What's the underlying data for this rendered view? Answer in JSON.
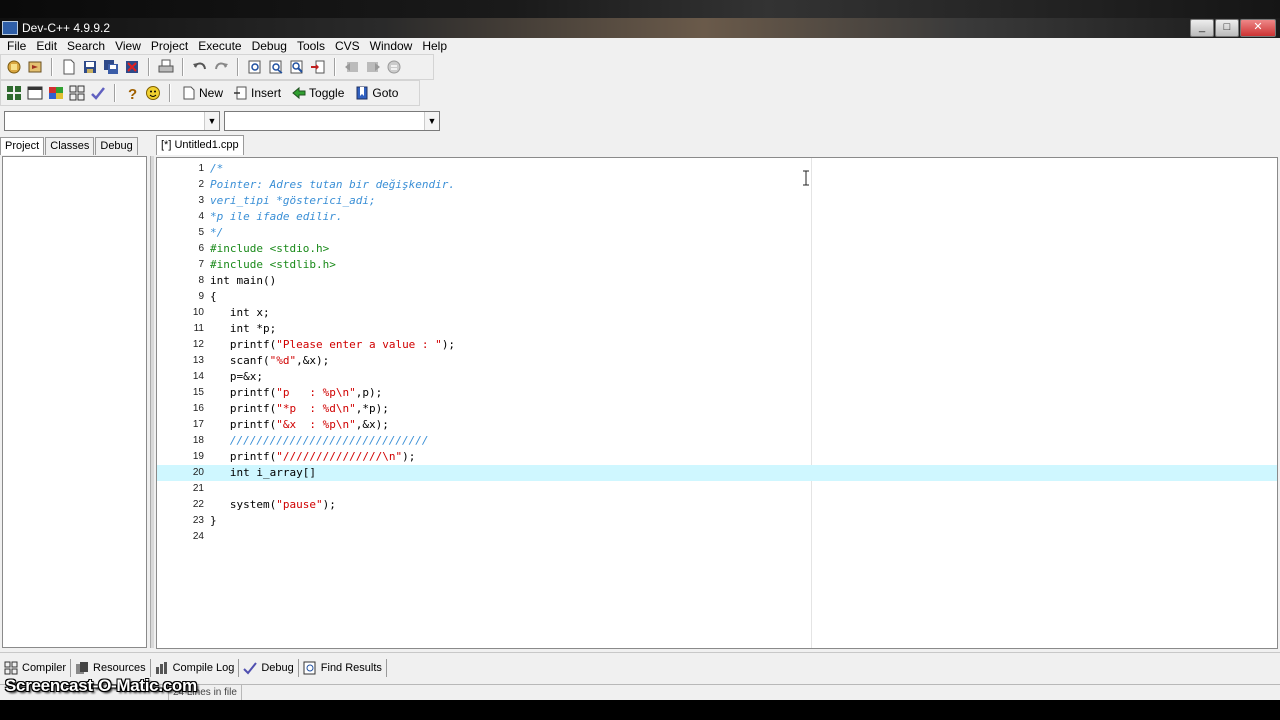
{
  "window": {
    "title": "Dev-C++ 4.9.9.2",
    "controls": [
      "_",
      "□",
      "✕"
    ]
  },
  "menu": [
    "File",
    "Edit",
    "Search",
    "View",
    "Project",
    "Execute",
    "Debug",
    "Tools",
    "CVS",
    "Window",
    "Help"
  ],
  "toolbar2": {
    "new_label": "New",
    "insert_label": "Insert",
    "toggle_label": "Toggle",
    "goto_label": "Goto"
  },
  "left_tabs": [
    "Project",
    "Classes",
    "Debug"
  ],
  "editor": {
    "tab_label": "[*] Untitled1.cpp",
    "current_line": 20,
    "lines": [
      {
        "n": "1",
        "segs": [
          {
            "t": "/*",
            "c": "comment"
          }
        ]
      },
      {
        "n": "2",
        "segs": [
          {
            "t": "Pointer: Adres tutan bir değişkendir.",
            "c": "comment"
          }
        ]
      },
      {
        "n": "3",
        "segs": [
          {
            "t": "veri_tipi *gösterici_adi;",
            "c": "comment"
          }
        ]
      },
      {
        "n": "4",
        "segs": [
          {
            "t": "*p ile ifade edilir.",
            "c": "comment"
          }
        ]
      },
      {
        "n": "5",
        "segs": [
          {
            "t": "*/",
            "c": "comment"
          }
        ]
      },
      {
        "n": "6",
        "segs": [
          {
            "t": "#include <stdio.h>",
            "c": "pre"
          }
        ]
      },
      {
        "n": "7",
        "segs": [
          {
            "t": "#include <stdlib.h>",
            "c": "pre"
          }
        ]
      },
      {
        "n": "8",
        "segs": [
          {
            "t": "int main()",
            "c": "norm"
          }
        ]
      },
      {
        "n": "9",
        "segs": [
          {
            "t": "{",
            "c": "norm"
          }
        ]
      },
      {
        "n": "10",
        "segs": [
          {
            "t": "   int x;",
            "c": "norm"
          }
        ]
      },
      {
        "n": "11",
        "segs": [
          {
            "t": "   int *p;",
            "c": "norm"
          }
        ]
      },
      {
        "n": "12",
        "segs": [
          {
            "t": "   printf(",
            "c": "norm"
          },
          {
            "t": "\"Please enter a value : \"",
            "c": "str"
          },
          {
            "t": ");",
            "c": "norm"
          }
        ]
      },
      {
        "n": "13",
        "segs": [
          {
            "t": "   scanf(",
            "c": "norm"
          },
          {
            "t": "\"%d\"",
            "c": "str"
          },
          {
            "t": ",&x);",
            "c": "norm"
          }
        ]
      },
      {
        "n": "14",
        "segs": [
          {
            "t": "   p=&x;",
            "c": "norm"
          }
        ]
      },
      {
        "n": "15",
        "segs": [
          {
            "t": "   printf(",
            "c": "norm"
          },
          {
            "t": "\"p   : %p\\n\"",
            "c": "str"
          },
          {
            "t": ",p);",
            "c": "norm"
          }
        ]
      },
      {
        "n": "16",
        "segs": [
          {
            "t": "   printf(",
            "c": "norm"
          },
          {
            "t": "\"*p  : %d\\n\"",
            "c": "str"
          },
          {
            "t": ",*p);",
            "c": "norm"
          }
        ]
      },
      {
        "n": "17",
        "segs": [
          {
            "t": "   printf(",
            "c": "norm"
          },
          {
            "t": "\"&x  : %p\\n\"",
            "c": "str"
          },
          {
            "t": ",&x);",
            "c": "norm"
          }
        ]
      },
      {
        "n": "18",
        "segs": [
          {
            "t": "   //////////////////////////////",
            "c": "comment"
          }
        ]
      },
      {
        "n": "19",
        "segs": [
          {
            "t": "   printf(",
            "c": "norm"
          },
          {
            "t": "\"///////////////\\n\"",
            "c": "str"
          },
          {
            "t": ");",
            "c": "norm"
          }
        ]
      },
      {
        "n": "20",
        "segs": [
          {
            "t": "   int i_array[]",
            "c": "norm"
          }
        ]
      },
      {
        "n": "21",
        "segs": [
          {
            "t": "",
            "c": "norm"
          }
        ]
      },
      {
        "n": "22",
        "segs": [
          {
            "t": "   system(",
            "c": "norm"
          },
          {
            "t": "\"pause\"",
            "c": "str"
          },
          {
            "t": ");",
            "c": "norm"
          }
        ]
      },
      {
        "n": "23",
        "segs": [
          {
            "t": "}",
            "c": "norm"
          }
        ]
      },
      {
        "n": "24",
        "segs": [
          {
            "t": "",
            "c": "norm"
          }
        ]
      }
    ]
  },
  "bottom_tabs": [
    {
      "label": "Compiler",
      "icon": "compiler-grid-icon"
    },
    {
      "label": "Resources",
      "icon": "resources-icon"
    },
    {
      "label": "Compile Log",
      "icon": "compile-log-chart-icon"
    },
    {
      "label": "Debug",
      "icon": "debug-check-icon"
    },
    {
      "label": "Find Results",
      "icon": "find-results-icon"
    }
  ],
  "status": {
    "lines_text": "24 Lines in file"
  },
  "watermark": "Screencast-O-Matic.com"
}
